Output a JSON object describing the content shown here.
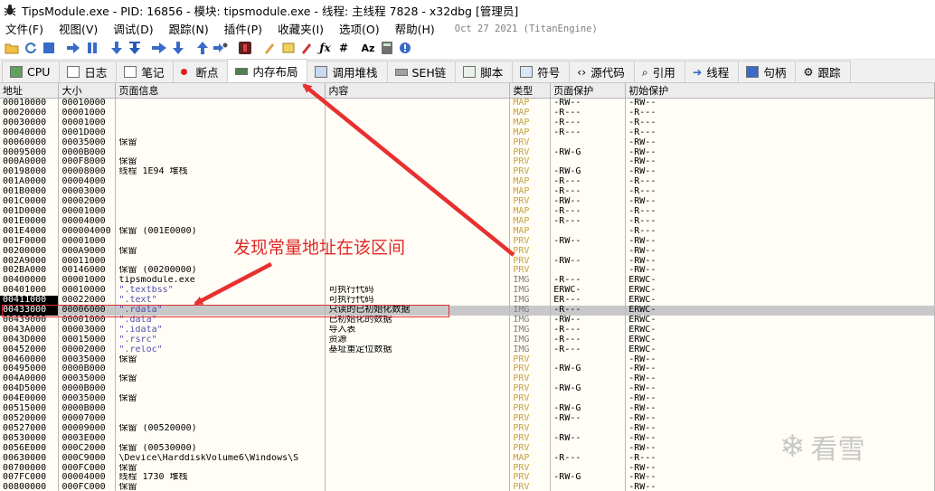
{
  "window": {
    "title": "TipsModule.exe - PID: 16856 - 模块: tipsmodule.exe - 线程: 主线程 7828 - x32dbg [管理员]"
  },
  "menu": {
    "items": [
      "文件(F)",
      "视图(V)",
      "调试(D)",
      "跟踪(N)",
      "插件(P)",
      "收藏夹(I)",
      "选项(O)",
      "帮助(H)"
    ],
    "build_date": "Oct 27 2021 (TitanEngine)"
  },
  "toolbar": {
    "icons": [
      "open-icon",
      "restart-icon",
      "stop-icon",
      "run-icon",
      "pause-icon",
      "step-into-icon",
      "step-over-icon",
      "trace-into-icon",
      "trace-over-icon",
      "execute-till-return-icon",
      "run-to-user-code-icon",
      "patches-icon",
      "comments-icon",
      "labels-icon",
      "bookmarks-icon",
      "functions-icon",
      "variables-icon",
      "font-icon",
      "calculator-icon",
      "help-icon"
    ]
  },
  "tabs": [
    {
      "label": "CPU",
      "icon": "cpu-icon"
    },
    {
      "label": "日志",
      "icon": "log-icon"
    },
    {
      "label": "笔记",
      "icon": "notes-icon"
    },
    {
      "label": "断点",
      "icon": "breakpoint-icon"
    },
    {
      "label": "内存布局",
      "icon": "memory-map-icon",
      "active": true
    },
    {
      "label": "调用堆栈",
      "icon": "call-stack-icon"
    },
    {
      "label": "SEH链",
      "icon": "seh-chain-icon"
    },
    {
      "label": "脚本",
      "icon": "script-icon"
    },
    {
      "label": "符号",
      "icon": "symbols-icon"
    },
    {
      "label": "源代码",
      "icon": "source-icon"
    },
    {
      "label": "引用",
      "icon": "references-icon"
    },
    {
      "label": "线程",
      "icon": "threads-icon"
    },
    {
      "label": "句柄",
      "icon": "handles-icon"
    },
    {
      "label": "跟踪",
      "icon": "trace-icon"
    }
  ],
  "memory": {
    "columns": [
      "地址",
      "大小",
      "页面信息",
      "内容",
      "类型",
      "页面保护",
      "初始保护"
    ],
    "rows": [
      [
        "00010000",
        "00010000",
        "",
        "",
        "MAP",
        "-RW--",
        "-RW--"
      ],
      [
        "00020000",
        "00001000",
        "",
        "",
        "MAP",
        "-R---",
        "-R---"
      ],
      [
        "00030000",
        "00001000",
        "",
        "",
        "MAP",
        "-R---",
        "-R---"
      ],
      [
        "00040000",
        "0001D000",
        "",
        "",
        "MAP",
        "-R---",
        "-R---"
      ],
      [
        "00060000",
        "00035000",
        "保留",
        "",
        "PRV",
        "",
        "-RW--"
      ],
      [
        "00095000",
        "0000B000",
        "",
        "",
        "PRV",
        "-RW-G",
        "-RW--"
      ],
      [
        "000A0000",
        "000F8000",
        "保留",
        "",
        "PRV",
        "",
        "-RW--"
      ],
      [
        "00198000",
        "00008000",
        "线程 1E94 堆栈",
        "",
        "PRV",
        "-RW-G",
        "-RW--"
      ],
      [
        "001A0000",
        "00004000",
        "",
        "",
        "MAP",
        "-R---",
        "-R---"
      ],
      [
        "001B0000",
        "00003000",
        "",
        "",
        "MAP",
        "-R---",
        "-R---"
      ],
      [
        "001C0000",
        "00002000",
        "",
        "",
        "PRV",
        "-RW--",
        "-RW--"
      ],
      [
        "001D0000",
        "00001000",
        "",
        "",
        "MAP",
        "-R---",
        "-R---"
      ],
      [
        "001E0000",
        "00004000",
        "",
        "",
        "MAP",
        "-R---",
        "-R---"
      ],
      [
        "001E4000",
        "000004000",
        "保留 (001E0000)",
        "",
        "MAP",
        "",
        "-R---"
      ],
      [
        "001F0000",
        "00001000",
        "",
        "",
        "PRV",
        "-RW--",
        "-RW--"
      ],
      [
        "00200000",
        "000A9000",
        "保留",
        "",
        "PRV",
        "",
        "-RW--"
      ],
      [
        "002A9000",
        "00011000",
        "",
        "",
        "PRV",
        "-RW--",
        "-RW--"
      ],
      [
        "002BA000",
        "00146000",
        "保留 (00200000)",
        "",
        "PRV",
        "",
        "-RW--"
      ],
      [
        "00400000",
        "00001000",
        "tipsmodule.exe",
        "",
        "IMG",
        "-R---",
        "ERWC-"
      ],
      [
        "00401000",
        "00010000",
        "\".textbss\"",
        "可执行代码",
        "IMG",
        "ERWC-",
        "ERWC-"
      ],
      [
        "00411000",
        "00022000",
        "\".text\"",
        "可执行代码",
        "IMG",
        "ER---",
        "ERWC-"
      ],
      [
        "00433000",
        "00006000",
        "\".rdata\"",
        "只读的已初始化数据",
        "IMG",
        "-R---",
        "ERWC-"
      ],
      [
        "00439000",
        "00001000",
        "\".data\"",
        "已初始化的数据",
        "IMG",
        "-RW--",
        "ERWC-"
      ],
      [
        "0043A000",
        "00003000",
        "\".idata\"",
        "导入表",
        "IMG",
        "-R---",
        "ERWC-"
      ],
      [
        "0043D000",
        "00015000",
        "\".rsrc\"",
        "资源",
        "IMG",
        "-R---",
        "ERWC-"
      ],
      [
        "00452000",
        "00002000",
        "\".reloc\"",
        "基址重定位数据",
        "IMG",
        "-R---",
        "ERWC-"
      ],
      [
        "00460000",
        "00035000",
        "保留",
        "",
        "PRV",
        "",
        "-RW--"
      ],
      [
        "00495000",
        "0000B000",
        "",
        "",
        "PRV",
        "-RW-G",
        "-RW--"
      ],
      [
        "004A0000",
        "00035000",
        "保留",
        "",
        "PRV",
        "",
        "-RW--"
      ],
      [
        "004D5000",
        "0000B000",
        "",
        "",
        "PRV",
        "-RW-G",
        "-RW--"
      ],
      [
        "004E0000",
        "00035000",
        "保留",
        "",
        "PRV",
        "",
        "-RW--"
      ],
      [
        "00515000",
        "0000B000",
        "",
        "",
        "PRV",
        "-RW-G",
        "-RW--"
      ],
      [
        "00520000",
        "00007000",
        "",
        "",
        "PRV",
        "-RW--",
        "-RW--"
      ],
      [
        "00527000",
        "00009000",
        "保留 (00520000)",
        "",
        "PRV",
        "",
        "-RW--"
      ],
      [
        "00530000",
        "0003E000",
        "",
        "",
        "PRV",
        "-RW--",
        "-RW--"
      ],
      [
        "0056E000",
        "000C2000",
        "保留 (00530000)",
        "",
        "PRV",
        "",
        "-RW--"
      ],
      [
        "00630000",
        "000C9000",
        "\\Device\\HarddiskVolume6\\Windows\\S",
        "",
        "MAP",
        "-R---",
        "-R---"
      ],
      [
        "00700000",
        "000FC000",
        "保留",
        "",
        "PRV",
        "",
        "-RW--"
      ],
      [
        "007FC000",
        "00004000",
        "线程 1730 堆栈",
        "",
        "PRV",
        "-RW-G",
        "-RW--"
      ],
      [
        "00800000",
        "000FC000",
        "保留",
        "",
        "PRV",
        "",
        "-RW--"
      ]
    ],
    "selected_address": "00433000",
    "current_address": "00411000"
  },
  "annotation": {
    "text": "发现常量地址在该区间",
    "color": "#e02828"
  },
  "watermark": {
    "text": "看雪"
  }
}
